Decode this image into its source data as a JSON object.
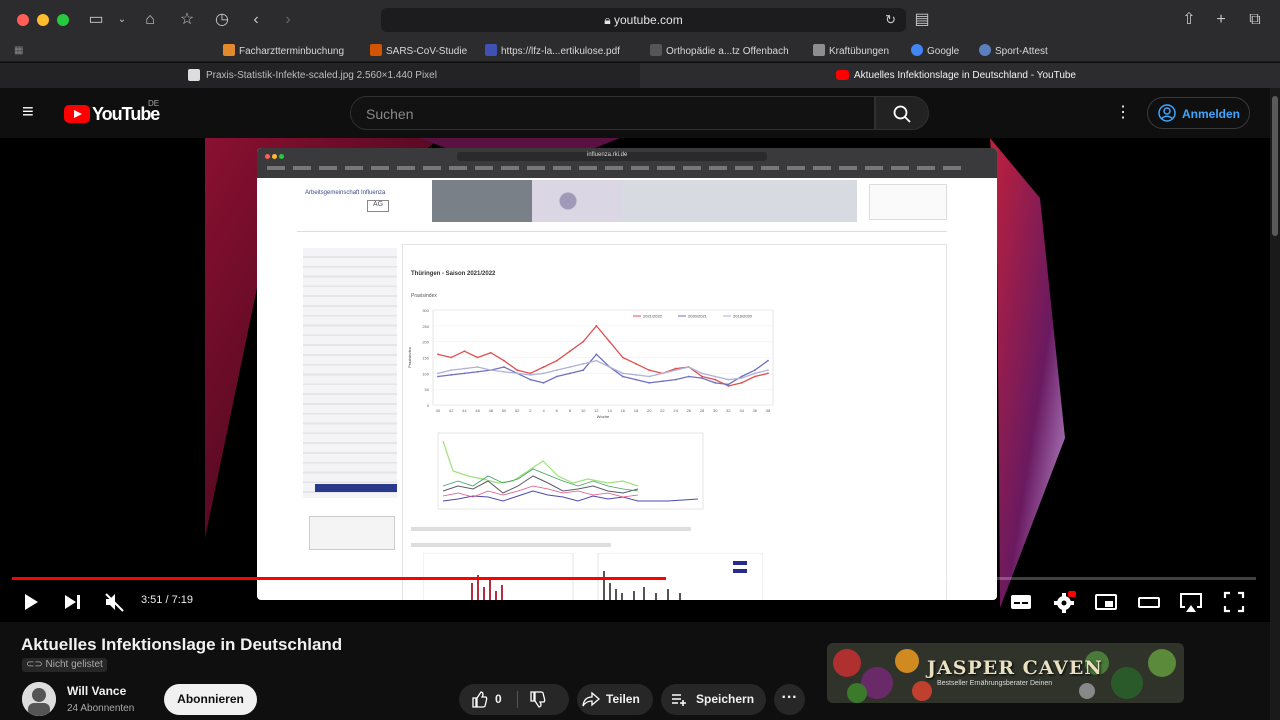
{
  "browser": {
    "url": "youtube.com",
    "bookmarks": [
      {
        "label": "Facharztterminbuchung",
        "color": "#e28a2c"
      },
      {
        "label": "SARS-CoV-Studie",
        "color": "#d35400"
      },
      {
        "label": "https://lfz-la...ertikulose.pdf",
        "color": "#3f51b5"
      },
      {
        "label": "Orthopädie a...tz Offenbach",
        "color": "#555"
      },
      {
        "label": "Kraftübungen",
        "color": "#8e8e8e"
      },
      {
        "label": "Google",
        "color": "#4285f4"
      },
      {
        "label": "Sport-Attest",
        "color": "#5b7fbf"
      }
    ],
    "tabs": [
      {
        "label": "Praxis-Statistik-Infekte-scaled.jpg 2.560×1.440 Pixel"
      },
      {
        "label": "Aktuelles Infektionslage in Deutschland - YouTube"
      }
    ]
  },
  "youtube": {
    "logo_text": "YouTube",
    "region": "DE",
    "search_placeholder": "Suchen",
    "signin_label": "Anmelden"
  },
  "player": {
    "time": "3:51 / 7:19",
    "progress_fraction": 0.526
  },
  "embedded_page": {
    "site": "influenza.rki.de",
    "org": "Arbeitsgemeinschaft Influenza",
    "heading": "Thüringen - Saison 2021/2022",
    "chart_title": "Praxisindex",
    "chart_legend": [
      "2021/2022",
      "2020/2021",
      "2019/2020"
    ],
    "y_label": "Praxisindex",
    "x_label": "Woche"
  },
  "video": {
    "title": "Aktuelles Infektionslage in Deutschland",
    "visibility": "Nicht gelistet",
    "channel": "Will Vance",
    "subscribers": "24 Abonnenten",
    "subscribe_label": "Abonnieren",
    "like_count": "0",
    "share_label": "Teilen",
    "save_label": "Speichern"
  },
  "ad": {
    "brand": "JASPER CAVEN",
    "tagline": "Bestseller Ernährungsberater Deinen"
  },
  "chart_data": {
    "type": "line",
    "title": "",
    "xlabel": "Woche",
    "ylabel": "Praxisindex",
    "ylim": [
      0,
      300
    ],
    "categories": [
      "40",
      "42",
      "44",
      "46",
      "48",
      "50",
      "52",
      "2",
      "4",
      "6",
      "8",
      "10",
      "12",
      "14",
      "16",
      "18",
      "20",
      "22",
      "24",
      "26",
      "28",
      "30",
      "32",
      "34",
      "36",
      "38"
    ],
    "series": [
      {
        "name": "2021/2022",
        "color": "#e05050",
        "values": [
          160,
          150,
          170,
          150,
          165,
          140,
          110,
          100,
          120,
          140,
          170,
          200,
          250,
          200,
          150,
          130,
          110,
          100,
          115,
          120,
          90,
          80,
          60,
          70,
          90,
          100
        ]
      },
      {
        "name": "2020/2021",
        "color": "#7070c0",
        "values": [
          90,
          95,
          100,
          105,
          110,
          120,
          100,
          80,
          70,
          90,
          100,
          110,
          160,
          120,
          90,
          80,
          70,
          75,
          80,
          90,
          85,
          70,
          65,
          90,
          110,
          140
        ]
      },
      {
        "name": "2019/2020",
        "color": "#b0b0d8",
        "values": [
          100,
          110,
          115,
          120,
          110,
          105,
          100,
          95,
          100,
          110,
          120,
          130,
          140,
          120,
          100,
          95,
          90,
          100,
          110,
          120,
          100,
          90,
          80,
          85,
          100,
          110
        ]
      }
    ]
  }
}
